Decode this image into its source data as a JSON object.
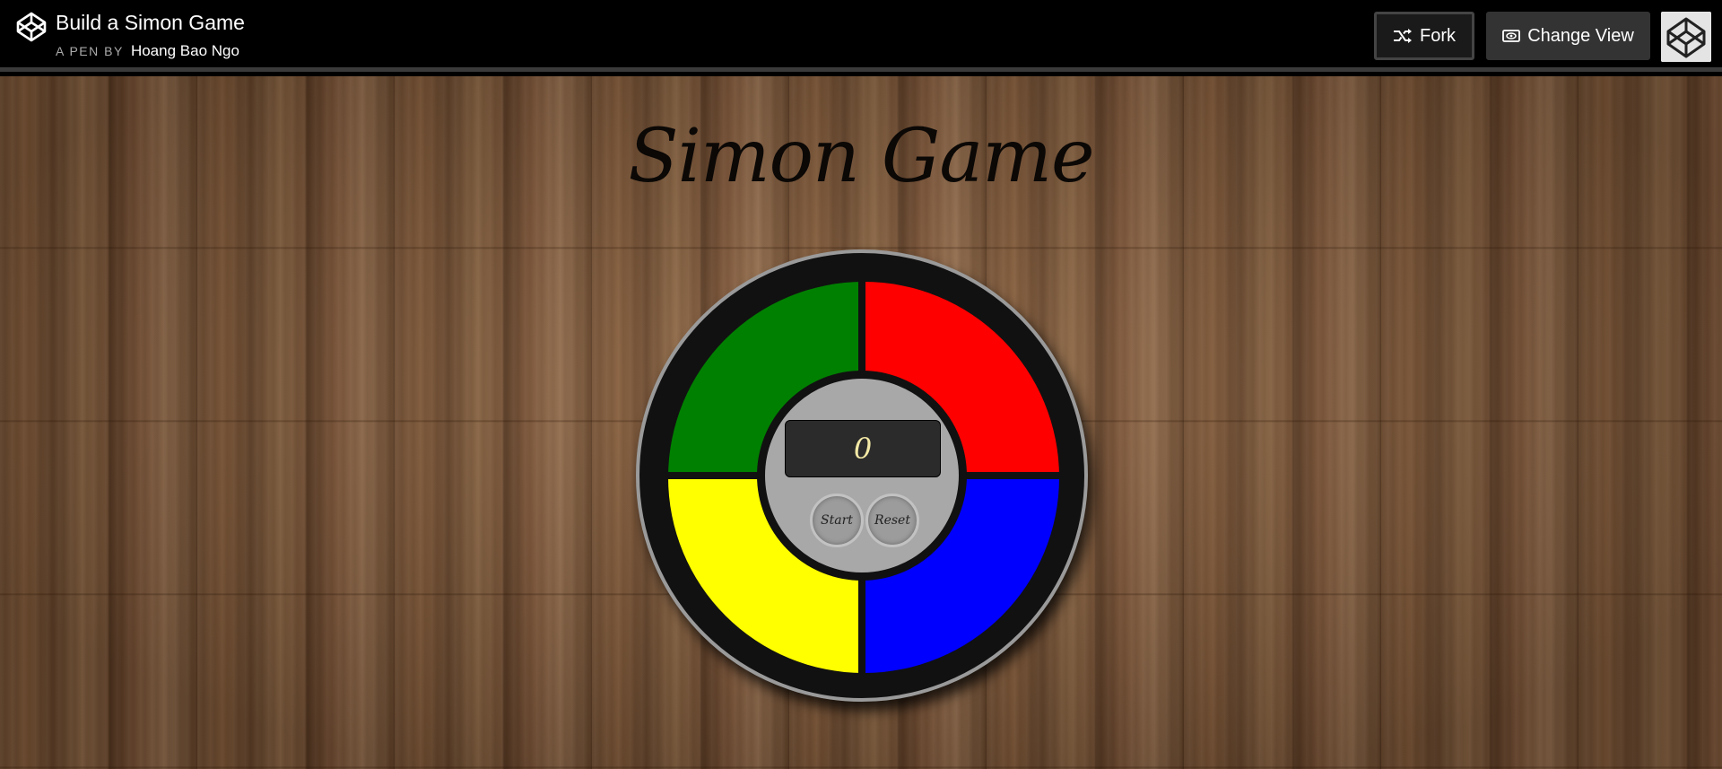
{
  "header": {
    "logo_icon": "codepen-logo-icon",
    "title": "Build a Simon Game",
    "by_label": "A PEN BY",
    "author": "Hoang Bao Ngo",
    "fork_label": "Fork",
    "fork_icon": "fork-icon",
    "change_view_label": "Change View",
    "change_view_icon": "eye-icon",
    "avatar_icon": "user-avatar-icon"
  },
  "game": {
    "title": "Simon Game",
    "count_display": "0",
    "start_label": "Start",
    "reset_label": "Reset",
    "pads": [
      {
        "name": "green",
        "color": "#008000"
      },
      {
        "name": "red",
        "color": "#ff0000"
      },
      {
        "name": "yellow",
        "color": "#ffff00"
      },
      {
        "name": "blue",
        "color": "#0000ff"
      }
    ]
  }
}
